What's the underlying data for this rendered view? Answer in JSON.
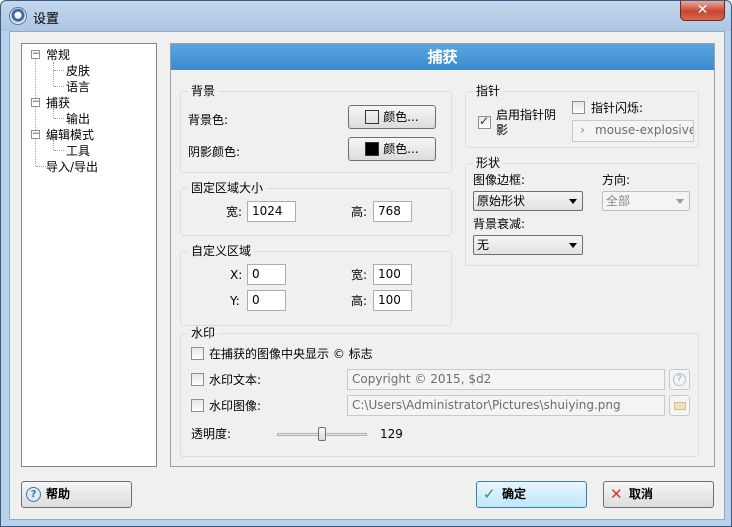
{
  "window": {
    "title": "设置",
    "close_glyph": "✕"
  },
  "tree": {
    "items": [
      {
        "label": "常规",
        "expanded": true
      },
      {
        "label": "皮肤"
      },
      {
        "label": "语言"
      },
      {
        "label": "捕获",
        "expanded": true
      },
      {
        "label": "输出"
      },
      {
        "label": "编辑模式",
        "expanded": true
      },
      {
        "label": "工具"
      },
      {
        "label": "导入/导出"
      }
    ],
    "collapse_glyph": "−"
  },
  "panel": {
    "title": "捕获"
  },
  "background_group": {
    "label": "背景",
    "bg_color_label": "背景色:",
    "bg_color_button": "颜色...",
    "bg_color_value": "#ffffff",
    "shadow_color_label": "阴影颜色:",
    "shadow_color_button": "颜色...",
    "shadow_color_value": "#000000"
  },
  "pointer_group": {
    "label": "指针",
    "enable_shadow_label": "启用指针阴影",
    "enable_shadow_checked": true,
    "blink_label": "指针闪烁:",
    "blink_checked": false,
    "cursor_file": "mouse-explosive.pn"
  },
  "fixed_region": {
    "label": "固定区域大小",
    "width_label": "宽:",
    "width_value": "1024",
    "height_label": "高:",
    "height_value": "768"
  },
  "shape_group": {
    "label": "形状",
    "border_label": "图像边框:",
    "border_value": "原始形状",
    "direction_label": "方向:",
    "direction_value": "全部",
    "fade_label": "背景衰减:",
    "fade_value": "无"
  },
  "custom_region": {
    "label": "自定义区域",
    "x_label": "X:",
    "x_value": "0",
    "width_label": "宽:",
    "width_value": "100",
    "y_label": "Y:",
    "y_value": "0",
    "height_label": "高:",
    "height_value": "100"
  },
  "watermark": {
    "label": "水印",
    "center_label": "在捕获的图像中央显示 © 标志",
    "center_checked": false,
    "text_label": "水印文本:",
    "text_checked": false,
    "text_value": "Copyright © 2015, $d2",
    "image_label": "水印图像:",
    "image_checked": false,
    "image_value": "C:\\Users\\Administrator\\Pictures\\shuiying.png",
    "opacity_label": "透明度:",
    "opacity_value": "129",
    "help_glyph": "?"
  },
  "footer": {
    "help_label": "帮助",
    "help_glyph": "?",
    "ok_label": "确定",
    "ok_glyph": "✓",
    "cancel_label": "取消",
    "cancel_glyph": "✕"
  }
}
